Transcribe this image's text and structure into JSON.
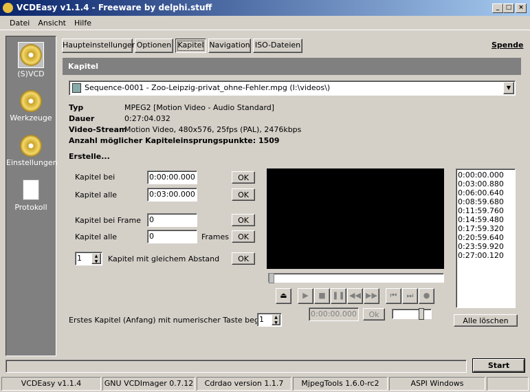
{
  "window": {
    "title": "VCDEasy v1.1.4 - Freeware by delphi.stuff"
  },
  "menu": [
    "Datei",
    "Ansicht",
    "Hilfe"
  ],
  "sidebar": [
    {
      "label": "(S)VCD"
    },
    {
      "label": "Werkzeuge"
    },
    {
      "label": "Einstellungen"
    },
    {
      "label": "Protokoll"
    }
  ],
  "tabs": [
    "Haupteinstellungen",
    "Optionen",
    "Kapitel",
    "Navigation",
    "ISO-Dateien"
  ],
  "spende": "Spende",
  "header": "Kapitel",
  "file_select": "Sequence-0001 - Zoo-Leipzig-privat_ohne-Fehler.mpg  (I:\\videos\\)",
  "info": {
    "typ_label": "Typ",
    "typ": "MPEG2   [Motion Video - Audio Standard]",
    "dauer_label": "Dauer",
    "dauer": "0:27:04.032",
    "vs_label": "Video-Stream",
    "vs": "Motion Video, 480x576, 25fps (PAL), 2476kbps",
    "anzahl": "Anzahl möglicher Kapiteleinsprungspunkte: 1509"
  },
  "erstelle": "Erstelle...",
  "form": {
    "kapitel_bei": "Kapitel bei",
    "kapitel_bei_val": "0:00:00.000",
    "kapitel_alle": "Kapitel alle",
    "kapitel_alle_val": "0:03:00.000",
    "frame_label": "Kapitel bei Frame",
    "frame_val": "0",
    "alle_frames_label": "Kapitel alle",
    "alle_frames_val": "0",
    "frames": "Frames",
    "gleich_val": "1",
    "gleich_label": "Kapitel mit gleichem Abstand",
    "ok": "OK"
  },
  "erstes": {
    "label": "Erstes Kapitel (Anfang) mit numerischer Taste beginnen",
    "value": "1"
  },
  "player": {
    "time": "0:00:00.000",
    "ok": "Ok"
  },
  "chapters": [
    "0:00:00.000",
    "0:03:00.880",
    "0:06:00.640",
    "0:08:59.680",
    "0:11:59.760",
    "0:14:59.480",
    "0:17:59.320",
    "0:20:59.640",
    "0:23:59.920",
    "0:27:00.120"
  ],
  "alle_loeschen": "Alle löschen",
  "start": "Start",
  "statusbar": [
    "VCDEasy v1.1.4",
    "GNU VCDImager 0.7.12",
    "Cdrdao version 1.1.7",
    "MjpegTools 1.6.0-rc2",
    "ASPI Windows"
  ]
}
